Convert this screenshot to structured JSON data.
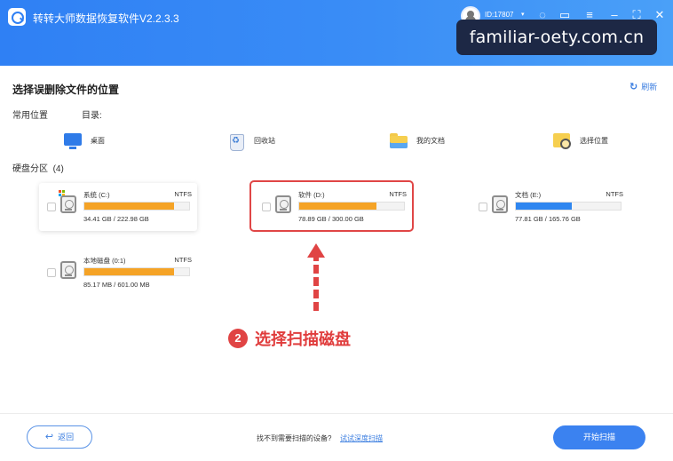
{
  "window": {
    "title": "转转大师数据恢复软件V2.2.3.3",
    "user_id": "ID:17807",
    "user_caret": "▾"
  },
  "watermark": {
    "text": "familiar-oety.com.cn"
  },
  "header": {
    "heading": "选择误删除文件的位置",
    "refresh_label": "刷新"
  },
  "common": {
    "label": "常用位置",
    "directory_label": "目录:",
    "items": [
      {
        "label": "桌面",
        "icon": "desktop-icon"
      },
      {
        "label": "回收站",
        "icon": "recycle-bin-icon"
      },
      {
        "label": "我的文档",
        "icon": "documents-folder-icon"
      },
      {
        "label": "选择位置",
        "icon": "choose-location-icon"
      }
    ]
  },
  "partitions": {
    "label": "硬盘分区",
    "count": "(4)",
    "drives": [
      {
        "name": "系统   (C:)",
        "fs": "NTFS",
        "size": "34.41 GB / 222.98 GB",
        "used_fraction": 0.86,
        "bar_color": "#f5a326"
      },
      {
        "name": "软件   (D:)",
        "fs": "NTFS",
        "size": "78.89 GB / 300.00 GB",
        "used_fraction": 0.74,
        "bar_color": "#f5a326"
      },
      {
        "name": "文档   (E:)",
        "fs": "NTFS",
        "size": "77.81 GB / 165.76 GB",
        "used_fraction": 0.53,
        "bar_color": "#2f86f0"
      },
      {
        "name": "本地磁盘   (0:1)",
        "fs": "NTFS",
        "size": "85.17 MB / 601.00 MB",
        "used_fraction": 0.86,
        "bar_color": "#f5a326"
      }
    ]
  },
  "annotation": {
    "step_number": "2",
    "step_text": "选择扫描磁盘"
  },
  "footer": {
    "back_label": "返回",
    "hint": "找不到需要扫描的设备?",
    "deep_scan_link": "试试深度扫描",
    "start_label": "开始扫描"
  },
  "colors": {
    "accent": "#3b82f0",
    "highlight": "#e04646",
    "titlebar": "#3a8df6"
  }
}
